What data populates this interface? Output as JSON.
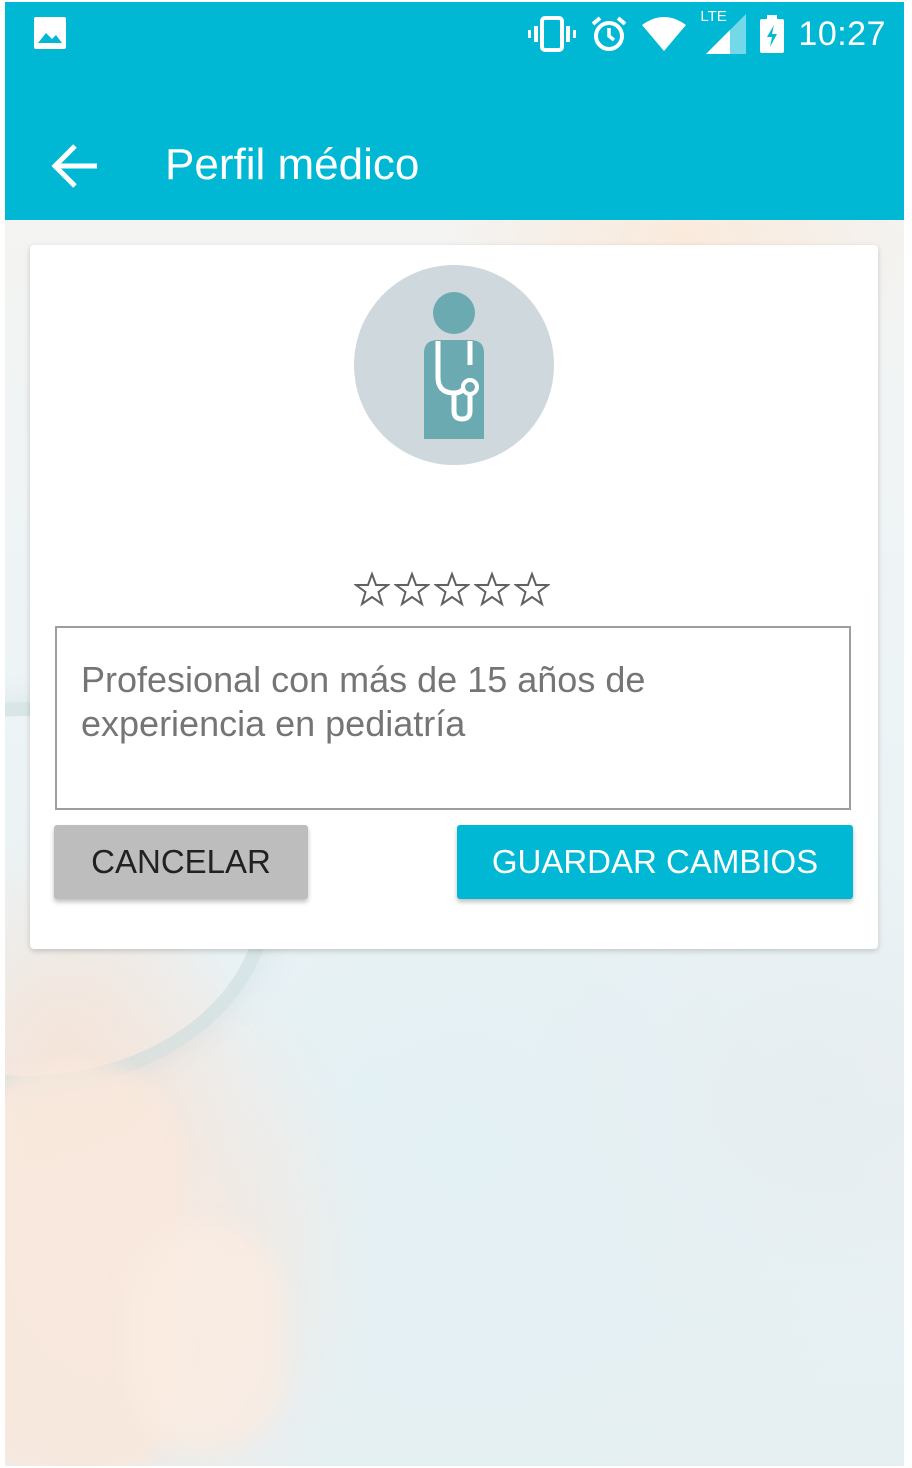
{
  "status_bar": {
    "time": "10:27",
    "network_label": "LTE",
    "icons": [
      "gallery-notification-icon",
      "vibrate-icon",
      "alarm-icon",
      "wifi-icon",
      "cell-signal-icon",
      "battery-charging-icon"
    ]
  },
  "app_bar": {
    "title": "Perfil médico",
    "back_icon": "arrow-back-icon"
  },
  "profile": {
    "avatar_icon": "doctor-stethoscope-icon",
    "rating": {
      "value": 0,
      "max": 5
    },
    "description": "Profesional con más de 15 años de experiencia en pediatría"
  },
  "actions": {
    "cancel_label": "CANCELAR",
    "save_label": "GUARDAR CAMBIOS"
  },
  "colors": {
    "primary": "#00b8d4",
    "cancel_button": "#bdbdbd",
    "avatar_bg": "#cfd8dc",
    "avatar_figure": "#6aaab0"
  }
}
